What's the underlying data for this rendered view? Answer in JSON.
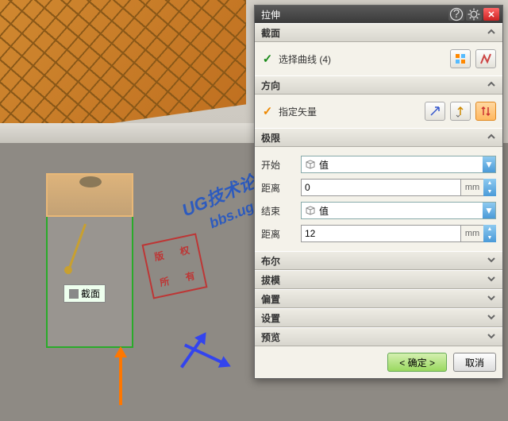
{
  "dialog": {
    "title": "拉伸",
    "sections": {
      "section": {
        "header": "截面",
        "curve_label": "选择曲线 (4)"
      },
      "direction": {
        "header": "方向",
        "vector_label": "指定矢量"
      },
      "limits": {
        "header": "极限",
        "start_label": "开始",
        "start_type": "值",
        "start_dist_label": "距离",
        "start_dist_value": "0",
        "start_unit": "mm",
        "end_label": "结束",
        "end_type": "值",
        "end_dist_label": "距离",
        "end_dist_value": "12",
        "end_unit": "mm"
      },
      "bool": "布尔",
      "draft": "拔模",
      "offset": "偏置",
      "settings": "设置",
      "preview": "预览"
    },
    "ok": "< 确定 >",
    "cancel": "取消"
  },
  "viewport": {
    "section_tag": "截面"
  },
  "watermark": {
    "stamp1": "版",
    "stamp2": "权",
    "stamp3": "所",
    "stamp4": "有",
    "line1": "UG技术论坛",
    "line2": "bbs.uggd.com"
  }
}
